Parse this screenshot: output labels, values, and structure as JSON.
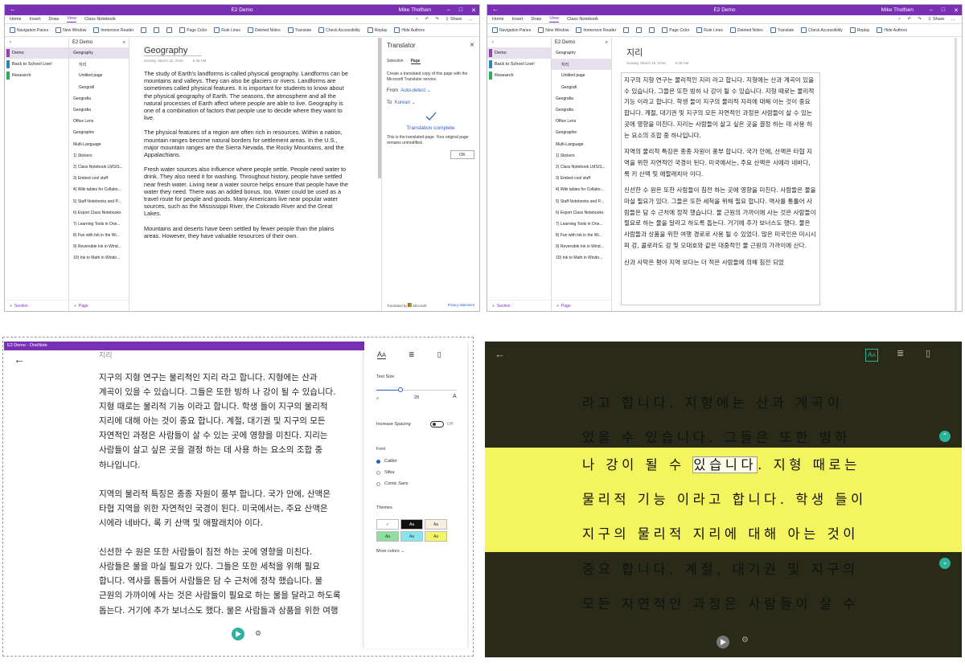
{
  "onenote": {
    "window_title": "E2 Demo",
    "user_name": "Mike Tholfsen",
    "menu_tabs": [
      "Home",
      "Insert",
      "Draw",
      "View",
      "Class Notebook"
    ],
    "menu_selected": "View",
    "menu_right": [
      "Share"
    ],
    "ribbon_items": [
      "Navigation Panes",
      "New Window",
      "Immersive Reader",
      "Page Color",
      "Rule Lines",
      "Deleted Notes",
      "Translate",
      "Check Accessibility",
      "Replay",
      "Hide Authors"
    ],
    "notebook_name": "E2 Demo",
    "sections": [
      {
        "label": "Demo",
        "color": "#8e44ad"
      },
      {
        "label": "Back to School Live!",
        "color": "#2e86c1"
      },
      {
        "label": "Research",
        "color": "#27ae60"
      }
    ],
    "add_section": "Section",
    "add_page": "Page",
    "pages_left": [
      {
        "label": "Geography",
        "sub": false
      },
      {
        "label": "지리",
        "sub": true
      },
      {
        "label": "Untitled page",
        "sub": true
      },
      {
        "label": "Geografi",
        "sub": true
      },
      {
        "label": "Geografia",
        "sub": false
      },
      {
        "label": "Geografia",
        "sub": false
      },
      {
        "label": "Office Lens",
        "sub": false
      },
      {
        "label": "Geographie",
        "sub": false
      },
      {
        "label": "Multi-Language",
        "sub": false
      },
      {
        "label": "1) Stickers",
        "sub": false
      },
      {
        "label": "2) Class Notebook LMS/S...",
        "sub": false
      },
      {
        "label": "3) Embed cool stuff",
        "sub": false
      },
      {
        "label": "4) Wiki tables for Collabo...",
        "sub": false
      },
      {
        "label": "5) Staff Notebooks and P...",
        "sub": false
      },
      {
        "label": "6) Export Class Notebooks",
        "sub": false
      },
      {
        "label": "7) Learning Tools in One...",
        "sub": false
      },
      {
        "label": "8) Fun with Ink in the Wi...",
        "sub": false
      },
      {
        "label": "9) Reversible Ink in Wind...",
        "sub": false
      },
      {
        "label": "10) Ink to Math in Windo...",
        "sub": false
      }
    ],
    "page_title_en": "Geography",
    "page_title_ko": "지리",
    "page_date": "Sunday, March 15, 2015",
    "page_time": "6:38 AM",
    "paragraphs_en": [
      "The study of Earth's landforms is called physical geography. Landforms can be mountains and valleys. They can also be glaciers or rivers. Landforms are sometimes called physical features. It is important for students to know about the physical geography of Earth. The seasons, the atmosphere and all the natural processes of Earth affect where people are able to live. Geography is one of a combination of factors that people use to decide where they want to live.",
      "The physical features of a region are often rich in resources. Within a nation, mountain ranges become natural borders for settlement areas. In the U.S., major mountain ranges are the Sierra Nevada, the Rocky Mountains, and the Appalachians.",
      "Fresh water sources also influence where people settle. People need water to drink. They also need it for washing. Throughout history, people have settled near fresh water. Living near a water source helps ensure that people have the water they need. There was an added bonus, too. Water could be used as a travel route for people and goods. Many Americans live near popular water sources, such as the Mississippi River, the Colorado River and the Great Lakes.",
      "Mountains and deserts have been settled by fewer people than the plains areas. However, they have valuable resources of their own."
    ],
    "paragraphs_ko": [
      "지구의 지형 연구는 물리적인 지리 라고 합니다. 지형에는 산과 계곡이 있을 수 있습니다. 그들은 또한 빙하 나 강이 될 수 있습니다. 지형 때로는 물리적 기능 이라고 합니다. 학생 들이 지구의 물리적 지리에 대해 아는 것이 중요 합니다. 계절, 대기권 및 지구의 모든 자연적인 과정은 사람들이 살 수 있는 곳에 영향을 미친다. 지리는 사람들이 살고 싶은 곳을 결정 하는 데 사용 하는 요소의 조합 중 하나입니다.",
      "지역의 물리적 특징은 종종 자원이 풍부 합니다. 국가 안에, 산맥은 타협 지역을 위한 자연적인 국경이 된다. 미국에서는, 주요 산맥은 시에라 네바다, 록 키 산맥 및 애팔래치아 이다.",
      "신선한 수 원은 또한 사람들이 침전 하는 곳에 영향을 미친다. 사람들은 물을 마실 필요가 있다. 그들은 또한 세척을 위해 필요 합니다. 역사를 통틀어 사람들은 담 수 근처에 정착 했습니다. 물 근원의 가까이에 사는 것은 사람들이 필요로 하는 물을 달라고 하도록 돕는다. 거기에 추가 보너스도 했다. 물은 사람들과 상품을 위한 여행 경로로 사용 될 수 있었다. 많은 미국인은 미시시피 강, 콜로라도 강 및 오대호와 같은 대중적인 물 근원의 가까이에 산다.",
      "산과 사막은 평야 지역 보다는 더 적은 사람들에 의해 침전 되었"
    ]
  },
  "translator": {
    "title": "Translator",
    "tabs": [
      "Selection",
      "Page"
    ],
    "selected_tab": "Page",
    "description": "Create a translated copy of this page with the Microsoft Translator service.",
    "from_label": "From",
    "from_value": "Auto-detect",
    "to_label": "To",
    "to_value": "Korean",
    "status": "Translation complete",
    "status_detail": "This is the translated page. Your original page remains unmodified.",
    "ok_button": "OK",
    "footer_left": "Translated by",
    "footer_brand": "Microsoft",
    "footer_right": "Privacy statement"
  },
  "immersive": {
    "window_title": "E2 Demo - OneNote",
    "title": "지리",
    "lines": [
      "지구의 지형 연구는 물리적인 지리 라고 합니다. 지형에는 산과",
      "계곡이 있을 수 있습니다. 그들은 또한 빙하 나 강이 될 수 있습니다.",
      "지형 때로는 물리적 기능 이라고 합니다. 학생 들이 지구의 물리적",
      "지리에 대해 아는 것이 중요 합니다. 계절, 대기권 및 지구의 모든",
      "자연적인 과정은 사람들이 살 수 있는 곳에 영향을 미친다. 지리는",
      "사람들이 살고 싶은 곳을 결정 하는 데 사용 하는 요소의 조합 중",
      "하나입니다.",
      "",
      "지역의 물리적 특징은 종종 자원이 풍부 합니다. 국가 안에, 산맥은",
      "타협 지역을 위한 자연적인 국경이 된다. 미국에서는, 주요 산맥은",
      "시에라 네바다, 록 키 산맥 및 애팔래치아 이다.",
      "",
      "신선한 수 원은 또한 사람들이 침전 하는 곳에 영향을 미친다.",
      "사람들은 물을 마실 필요가 있다. 그들은 또한 세척을 위해 필요",
      "합니다. 역사를 통틀어 사람들은 담 수 근처에 정착 했습니다. 물",
      "근원의 가까이에 사는 것은 사람들이 필요로 하는 물을 달라고 하도록",
      "돕는다. 거기에 추가 보너스도 했다. 물은 사람들과 상품을 위한 여행"
    ],
    "text_size_label": "Text Size",
    "text_size_value": "28",
    "text_size_fraction": 0.3,
    "spacing_label": "Increase Spacing",
    "spacing_state": "Off",
    "font_label": "Font",
    "fonts": [
      "Calibri",
      "Sitka",
      "Comic Sans"
    ],
    "font_selected": "Calibri",
    "themes_label": "Themes",
    "theme_swatch_label": "Aa",
    "theme_colors": [
      "#ffffff",
      "#111111",
      "#f5efdc",
      "#8fe0a0",
      "#88e4ee",
      "#f4f46a"
    ],
    "more_colors": "More colors"
  },
  "focus": {
    "lines_top": [
      "라고 합니다. 지형에는 산과 계곡이",
      "있을 수 있습니다. 그들은 또한 빙하"
    ],
    "line_highlight_pre": "나 강이 될 수 ",
    "line_highlight_word": "있습니다",
    "line_highlight_post": ". 지형 때로는",
    "lines_mid": [
      "물리적 기능 이라고 합니다. 학생 들이",
      "지구의 물리적 지리에 대해 아는 것이"
    ],
    "lines_bottom": [
      "중요 합니다. 계절, 대기권 및 지구의",
      "모든 자연적인 과정은 사람들이 살 수"
    ],
    "colors": {
      "bg": "#2a2a18",
      "band": "#f4f45e",
      "accent": "#2db39c"
    }
  }
}
